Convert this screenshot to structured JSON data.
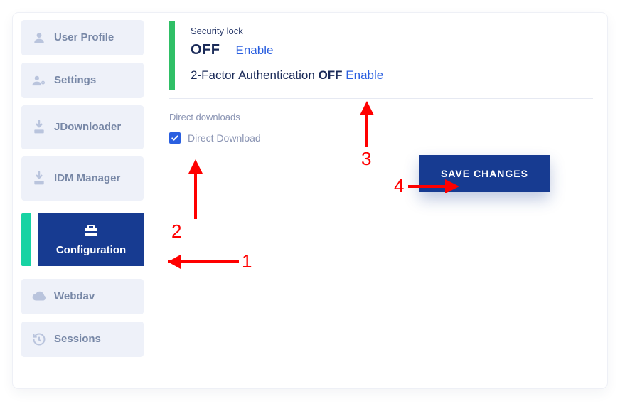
{
  "sidebar": {
    "items": [
      {
        "label": "User Profile"
      },
      {
        "label": "Settings"
      },
      {
        "label": "JDownloader"
      },
      {
        "label": "IDM Manager"
      },
      {
        "label": "Configuration"
      },
      {
        "label": "Webdav"
      },
      {
        "label": "Sessions"
      }
    ]
  },
  "security": {
    "section_label": "Security lock",
    "status": "OFF",
    "enable_label": "Enable",
    "tfa_label": "2-Factor Authentication",
    "tfa_status": "OFF",
    "tfa_enable_label": "Enable"
  },
  "downloads": {
    "section_label": "Direct downloads",
    "checkbox_label": "Direct Download",
    "checked": true
  },
  "actions": {
    "save_label": "SAVE CHANGES"
  },
  "annotations": {
    "n1": "1",
    "n2": "2",
    "n3": "3",
    "n4": "4"
  }
}
